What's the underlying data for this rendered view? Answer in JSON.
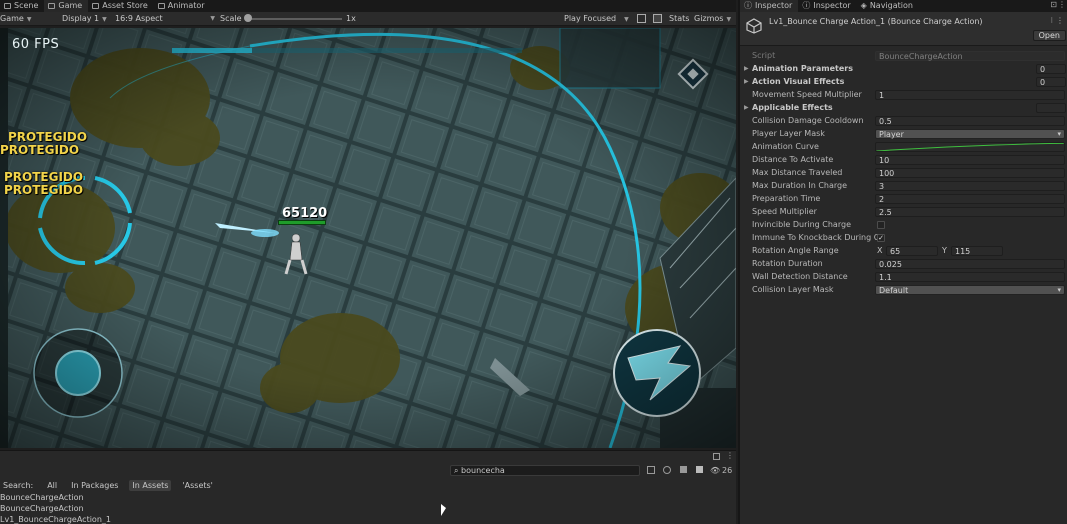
{
  "editor": {
    "tabs": [
      {
        "label": "Scene",
        "icon": "scene-icon",
        "active": false
      },
      {
        "label": "Game",
        "icon": "gamepad-icon",
        "active": true
      },
      {
        "label": "Asset Store",
        "icon": "store-icon",
        "active": false
      },
      {
        "label": "Animator",
        "icon": "animator-icon",
        "active": false
      }
    ]
  },
  "game_toolbar": {
    "mode": "Game",
    "display": "Display 1",
    "aspect": "16:9 Aspect",
    "scale_label": "Scale",
    "scale_value": "1x",
    "play_mode": "Play Focused",
    "stats": "Stats",
    "gizmos": "Gizmos"
  },
  "game": {
    "fps": "60 FPS",
    "protected_texts": [
      "PROTEGIDO",
      "PROTEGIDO",
      "PROTEGIDO",
      "PROTEGIDO"
    ],
    "damage_number": "65120"
  },
  "project_panel": {
    "search_value": "bouncecha",
    "filters": [
      "All",
      "In Packages",
      "In Assets",
      "'Assets'"
    ],
    "selected_filter": "In Assets",
    "results": [
      "BounceChargeAction",
      "BounceChargeAction",
      "Lv1_BounceChargeAction_1"
    ],
    "count": "26"
  },
  "inspector": {
    "tabs": [
      {
        "label": "Inspector",
        "active": true
      },
      {
        "label": "Inspector",
        "active": false
      },
      {
        "label": "Navigation",
        "active": false
      }
    ],
    "title": "Lv1_Bounce Charge Action_1 (Bounce Charge Action)",
    "open_label": "Open",
    "script_label": "Script",
    "script_value": "BounceChargeAction",
    "fields": {
      "animation_parameters": {
        "label": "Animation Parameters",
        "value": "0"
      },
      "action_visual_effects": {
        "label": "Action Visual Effects",
        "value": "0"
      },
      "movement_speed_multiplier": {
        "label": "Movement Speed Multiplier",
        "value": "1"
      },
      "applicable_effects": {
        "label": "Applicable Effects",
        "value": ""
      },
      "collision_damage_cooldown": {
        "label": "Collision Damage Cooldown",
        "value": "0.5"
      },
      "player_layer_mask": {
        "label": "Player Layer Mask",
        "value": "Player"
      },
      "animation_curve": {
        "label": "Animation Curve"
      },
      "distance_to_activate": {
        "label": "Distance To Activate",
        "value": "10"
      },
      "max_distance_traveled": {
        "label": "Max Distance Traveled",
        "value": "100"
      },
      "max_duration_in_charge": {
        "label": "Max Duration In Charge",
        "value": "3"
      },
      "preparation_time": {
        "label": "Preparation Time",
        "value": "2"
      },
      "speed_multiplier": {
        "label": "Speed Multiplier",
        "value": "2.5"
      },
      "invincible_during_charge": {
        "label": "Invincible During Charge",
        "checked": false
      },
      "immune_to_knockback": {
        "label": "Immune To Knockback During C",
        "checked": true
      },
      "rotation_angle_range": {
        "label": "Rotation Angle Range",
        "x_label": "X",
        "x": "65",
        "y_label": "Y",
        "y": "115"
      },
      "rotation_duration": {
        "label": "Rotation Duration",
        "value": "0.025"
      },
      "wall_detection_distance": {
        "label": "Wall Detection Distance",
        "value": "1.1"
      },
      "collision_layer_mask": {
        "label": "Collision Layer Mask",
        "value": "Default"
      }
    }
  },
  "colors": {
    "accent_cyan": "#27c8e6",
    "protected_yellow": "#f2d44a",
    "hp_green": "#1f9c2a"
  }
}
